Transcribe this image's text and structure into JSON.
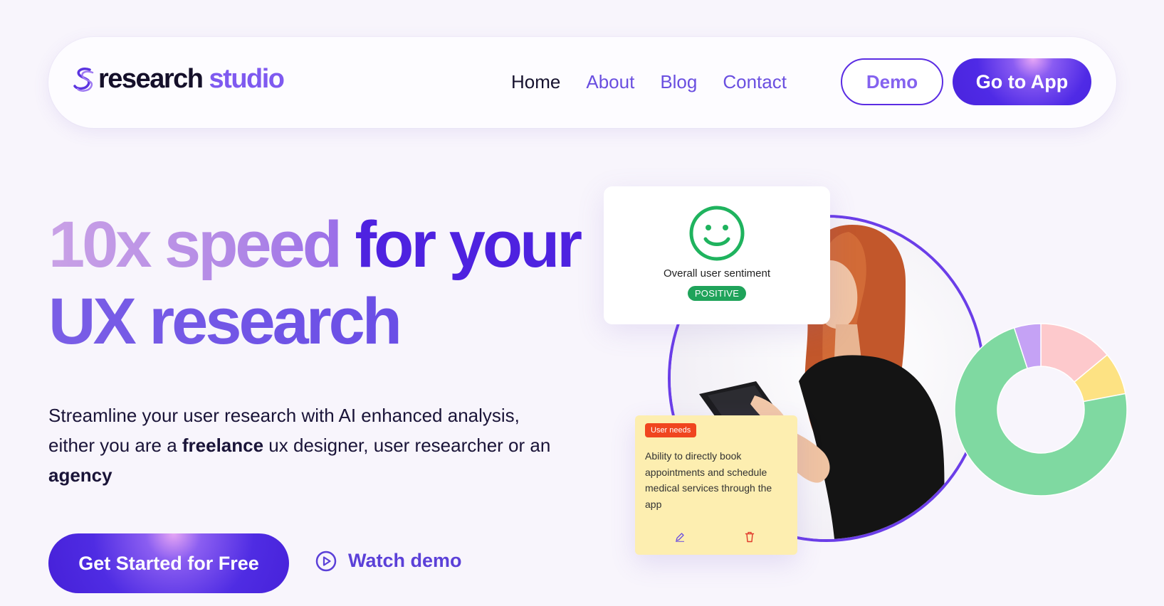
{
  "brand": {
    "name_part1": "research",
    "name_part2": "studio",
    "logo_icon": "s-logo-icon",
    "accent_color": "#4e22e0"
  },
  "nav": {
    "links": [
      {
        "label": "Home",
        "active": true
      },
      {
        "label": "About",
        "active": false
      },
      {
        "label": "Blog",
        "active": false
      },
      {
        "label": "Contact",
        "active": false
      }
    ],
    "demo_label": "Demo",
    "app_label": "Go to App"
  },
  "hero": {
    "title_fade": "10x speed",
    "title_strong": "for your",
    "title_line2": "UX research",
    "desc_part1": "Streamline your user research with AI enhanced analysis, either you are a ",
    "desc_bold1": "freelance",
    "desc_part2": " ux designer, user researcher or an ",
    "desc_bold2": "agency",
    "cta_label": "Get Started for Free",
    "watch_label": "Watch demo",
    "watch_icon": "play-circle-icon"
  },
  "sentiment_card": {
    "icon": "smiley-icon",
    "label": "Overall user sentiment",
    "badge": "POSITIVE",
    "badge_color": "#1fa35a"
  },
  "note_card": {
    "badge": "User needs",
    "text": "Ability to directly book appointments and schedule medical services through the app",
    "icons": [
      "pencil-icon",
      "trash-icon"
    ],
    "bg_color": "#fdeeb0"
  },
  "donut_chart": {
    "segments": [
      {
        "color": "#fdc9cc",
        "fraction": 0.14
      },
      {
        "color": "#fde283",
        "fraction": 0.08
      },
      {
        "color": "#7fd9a1",
        "fraction": 0.73
      },
      {
        "color": "#c5a2f5",
        "fraction": 0.05
      }
    ]
  }
}
